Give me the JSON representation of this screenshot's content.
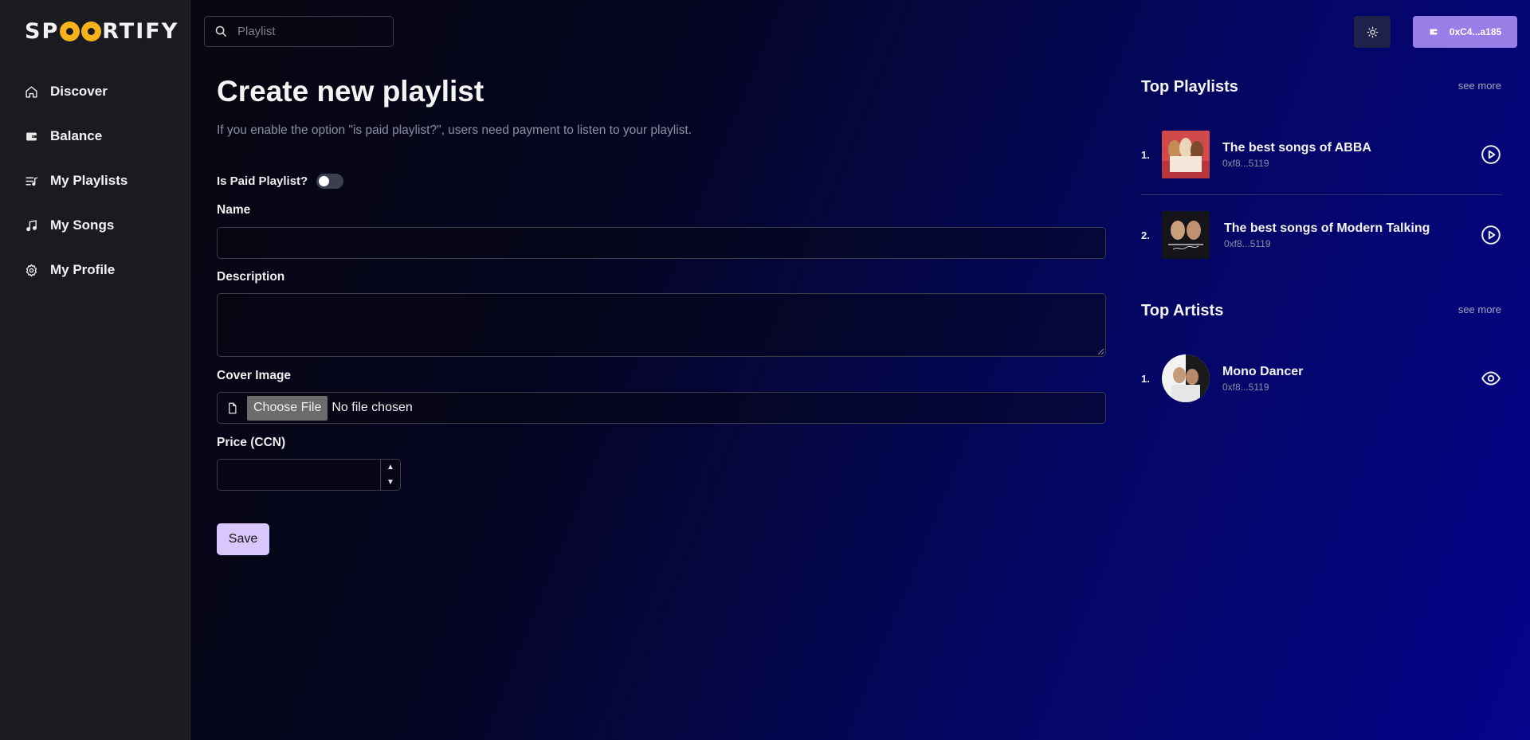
{
  "app": {
    "logo_left": "SP",
    "logo_right": "RTIFY"
  },
  "sidebar": {
    "items": [
      {
        "label": "Discover",
        "icon": "home-icon"
      },
      {
        "label": "Balance",
        "icon": "wallet-icon"
      },
      {
        "label": "My Playlists",
        "icon": "playlist-icon"
      },
      {
        "label": "My Songs",
        "icon": "music-note-icon"
      },
      {
        "label": "My Profile",
        "icon": "gear-icon"
      }
    ]
  },
  "header": {
    "search_placeholder": "Playlist",
    "wallet_address": "0xC4...a185"
  },
  "form": {
    "title": "Create new playlist",
    "subtitle": "If you enable the option \"is paid playlist?\", users need payment to listen to your playlist.",
    "paid_label": "Is Paid Playlist?",
    "paid_enabled": false,
    "name_label": "Name",
    "description_label": "Description",
    "cover_label": "Cover Image",
    "choose_file_label": "Choose File",
    "no_file_label": "No file chosen",
    "price_label": "Price (CCN)",
    "save_label": "Save"
  },
  "top_playlists": {
    "title": "Top Playlists",
    "see_more": "see more",
    "items": [
      {
        "rank": "1.",
        "title": "The best songs of ABBA",
        "owner": "0xf8...5119"
      },
      {
        "rank": "2.",
        "title": "The best songs of Modern Talking",
        "owner": "0xf8...5119"
      }
    ]
  },
  "top_artists": {
    "title": "Top Artists",
    "see_more": "see more",
    "items": [
      {
        "rank": "1.",
        "title": "Mono Dancer",
        "owner": "0xf8...5119"
      }
    ]
  },
  "colors": {
    "sidebar_bg": "#191b21",
    "accent": "#9b7de8",
    "save_bg": "#d9c6fb",
    "logo_yellow": "#f6b21a"
  }
}
